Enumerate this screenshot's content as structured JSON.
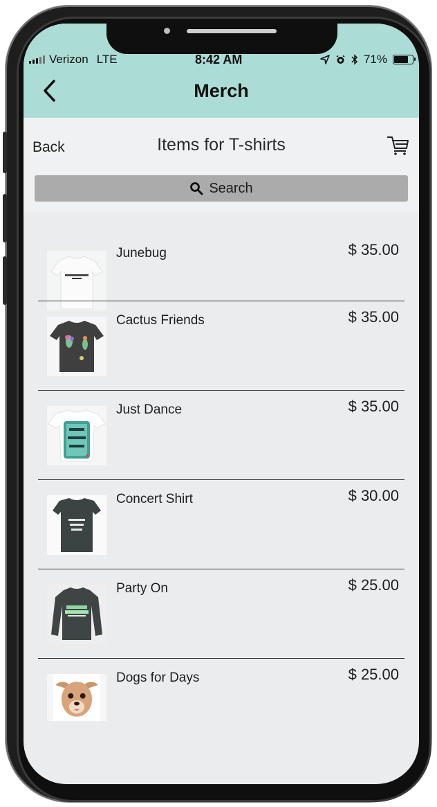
{
  "status_bar": {
    "carrier": "Verizon",
    "network": "LTE",
    "time": "8:42 AM",
    "battery": "71%",
    "battery_level": 0.71
  },
  "nav": {
    "back_icon": "chevron-left-icon",
    "title": "Merch"
  },
  "subheader": {
    "back_label": "Back",
    "heading": "Items for T-shirts",
    "cart_icon": "cart-icon"
  },
  "search": {
    "label": "Search",
    "icon": "search-icon"
  },
  "items": [
    {
      "name": "Junebug",
      "price": "$ 35.00",
      "image": "white-tshirt"
    },
    {
      "name": "Cactus Friends",
      "price": "$ 35.00",
      "image": "charcoal-tshirt-cactus"
    },
    {
      "name": "Just Dance",
      "price": "$ 35.00",
      "image": "white-tshirt-lets-dance"
    },
    {
      "name": "Concert Shirt",
      "price": "$ 30.00",
      "image": "dark-tshirt-concert"
    },
    {
      "name": "Party On",
      "price": "$ 25.00",
      "image": "dark-longsleeve-party"
    },
    {
      "name": "Dogs for Days",
      "price": "$ 25.00",
      "image": "chihuahua-shirt"
    }
  ],
  "colors": {
    "header_bg": "#abdcd6",
    "page_bg": "#ebecee",
    "searchbar_bg": "#ababab"
  }
}
